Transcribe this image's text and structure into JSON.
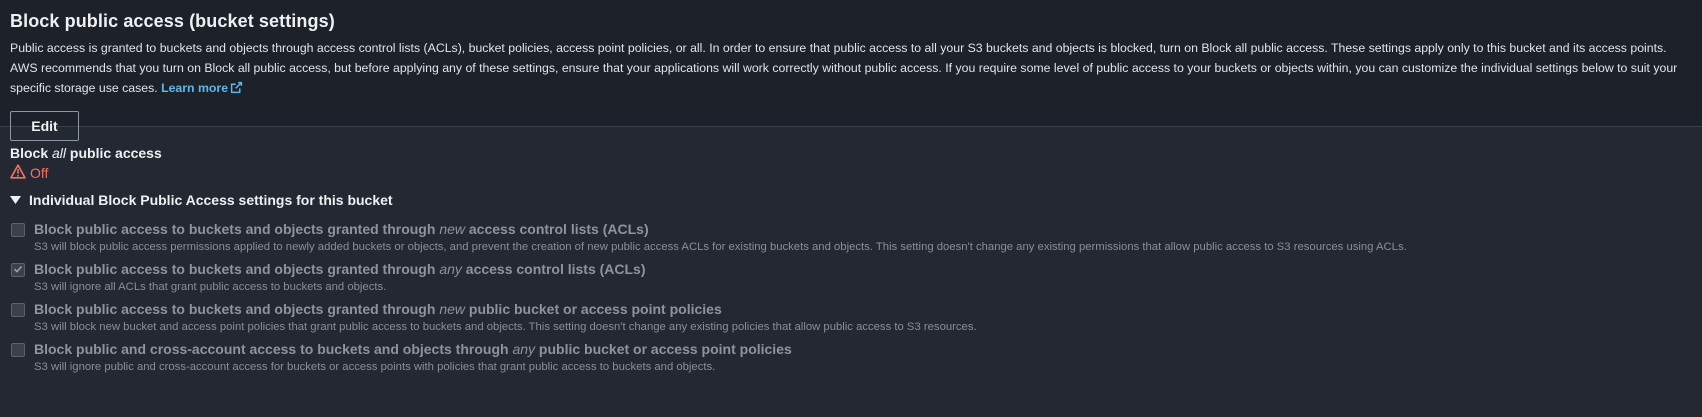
{
  "header": {
    "title": "Block public access (bucket settings)",
    "description": "Public access is granted to buckets and objects through access control lists (ACLs), bucket policies, access point policies, or all. In order to ensure that public access to all your S3 buckets and objects is blocked, turn on Block all public access. These settings apply only to this bucket and its access points. AWS recommends that you turn on Block all public access, but before applying any of these settings, ensure that your applications will work correctly without public access. If you require some level of public access to your buckets or objects within, you can customize the individual settings below to suit your specific storage use cases.",
    "learn_more": "Learn more",
    "edit_label": "Edit"
  },
  "block_all": {
    "label_pre": "Block ",
    "label_em": "all",
    "label_post": " public access",
    "status": "Off",
    "status_color": "#f27162"
  },
  "individual": {
    "toggle_label": "Individual Block Public Access settings for this bucket",
    "options": [
      {
        "title_pre": "Block public access to buckets and objects granted through ",
        "title_em": "new",
        "title_post": " access control lists (ACLs)",
        "desc": "S3 will block public access permissions applied to newly added buckets or objects, and prevent the creation of new public access ACLs for existing buckets and objects. This setting doesn't change any existing permissions that allow public access to S3 resources using ACLs.",
        "checked": false
      },
      {
        "title_pre": "Block public access to buckets and objects granted through ",
        "title_em": "any",
        "title_post": " access control lists (ACLs)",
        "desc": "S3 will ignore all ACLs that grant public access to buckets and objects.",
        "checked": true
      },
      {
        "title_pre": "Block public access to buckets and objects granted through ",
        "title_em": "new",
        "title_post": " public bucket or access point policies",
        "desc": "S3 will block new bucket and access point policies that grant public access to buckets and objects. This setting doesn't change any existing policies that allow public access to S3 resources.",
        "checked": false
      },
      {
        "title_pre": "Block public and cross-account access to buckets and objects through ",
        "title_em": "any",
        "title_post": " public bucket or access point policies",
        "desc": "S3 will ignore public and cross-account access for buckets or access points with policies that grant public access to buckets and objects.",
        "checked": false
      }
    ]
  },
  "colors": {
    "background": "#232833",
    "header_background": "#1d222a",
    "link": "#5fb8e8",
    "warning": "#f27162"
  },
  "icons": {
    "external_link": "external-link-icon",
    "warning": "warning-icon",
    "caret": "caret-down-icon",
    "checkbox_checked": "check-icon"
  }
}
